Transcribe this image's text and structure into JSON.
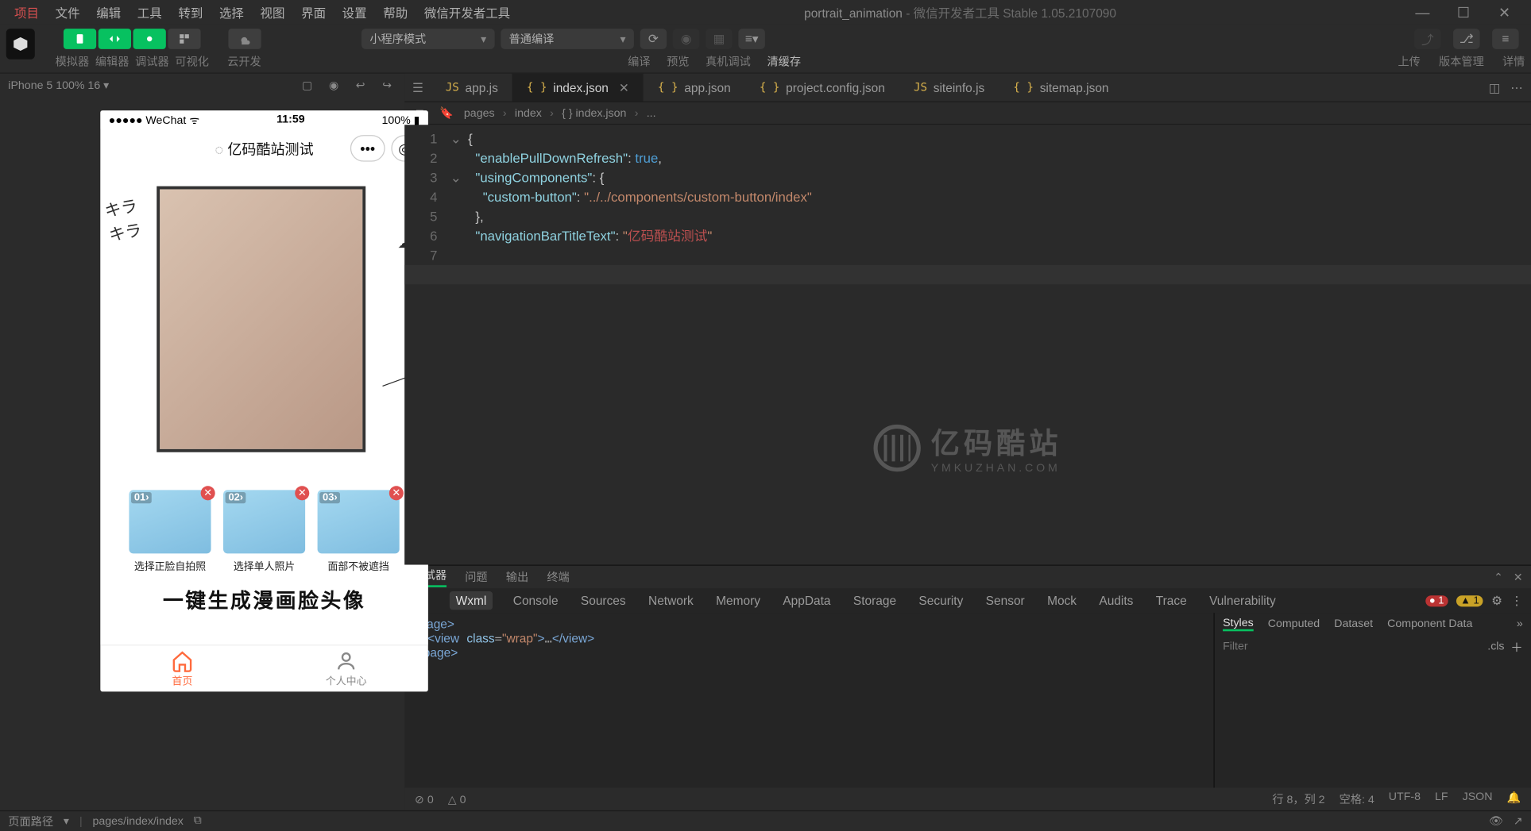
{
  "menubar": {
    "items": [
      "项目",
      "文件",
      "编辑",
      "工具",
      "转到",
      "选择",
      "视图",
      "界面",
      "设置",
      "帮助",
      "微信开发者工具"
    ],
    "title_project": "portrait_animation",
    "title_suffix": " - 微信开发者工具 Stable 1.05.2107090"
  },
  "toolbar": {
    "group1_labels": [
      "模拟器",
      "编辑器",
      "调试器",
      "可视化"
    ],
    "group2_label": "云开发",
    "mode_select": "小程序模式",
    "compile_select": "普通编译",
    "center_labels": [
      "编译",
      "预览",
      "真机调试",
      "清缓存"
    ],
    "right_labels": [
      "上传",
      "版本管理",
      "详情"
    ]
  },
  "simulator": {
    "device_label": "iPhone 5 100% 16",
    "wechat_status": {
      "carrier": "●●●●● WeChat",
      "time": "11:59",
      "battery": "100%"
    },
    "nav_title": "亿码酷站测试",
    "thumbs": [
      {
        "badge": "01›",
        "caption": "选择正脸自拍照"
      },
      {
        "badge": "02›",
        "caption": "选择单人照片"
      },
      {
        "badge": "03›",
        "caption": "面部不被遮挡"
      }
    ],
    "slogan": "一键生成漫画脸头像",
    "tabs": [
      "首页",
      "个人中心"
    ]
  },
  "editor": {
    "tabs": [
      {
        "icon": "JS",
        "name": "app.js"
      },
      {
        "icon": "{ }",
        "name": "index.json",
        "active": true
      },
      {
        "icon": "{ }",
        "name": "app.json"
      },
      {
        "icon": "{ }",
        "name": "project.config.json"
      },
      {
        "icon": "JS",
        "name": "siteinfo.js"
      },
      {
        "icon": "{ }",
        "name": "sitemap.json"
      }
    ],
    "breadcrumb": [
      "pages",
      "index",
      "{ } index.json",
      "..."
    ],
    "code_lines": [
      "{",
      "  \"enablePullDownRefresh\": true,",
      "  \"usingComponents\": {",
      "    \"custom-button\": \"../../components/custom-button/index\"",
      "  },",
      "  \"navigationBarTitleText\": \"亿码酷站测试\"",
      "",
      "}"
    ],
    "watermark": {
      "main": "亿码酷站",
      "sub": "YMKUZHAN.COM"
    }
  },
  "devtools": {
    "tabs1": [
      "调试器",
      "问题",
      "输出",
      "终端"
    ],
    "tabs2": [
      "Wxml",
      "Console",
      "Sources",
      "Network",
      "Memory",
      "AppData",
      "Storage",
      "Security",
      "Sensor",
      "Mock",
      "Audits",
      "Trace",
      "Vulnerability"
    ],
    "err_count": "1",
    "warn_count": "1",
    "wxml": [
      "<page>",
      "▸ <view class=\"wrap\">…</view>",
      "</page>"
    ],
    "right_tabs": [
      "Styles",
      "Computed",
      "Dataset",
      "Component Data"
    ],
    "filter_placeholder": "Filter",
    "cls_label": ".cls"
  },
  "editor_status": {
    "left": [
      "⊘ 0",
      "△ 0"
    ],
    "right": [
      "行 8，列 2",
      "空格: 4",
      "UTF-8",
      "LF",
      "JSON"
    ]
  },
  "statusbar": {
    "left_label": "页面路径",
    "path": "pages/index/index"
  }
}
